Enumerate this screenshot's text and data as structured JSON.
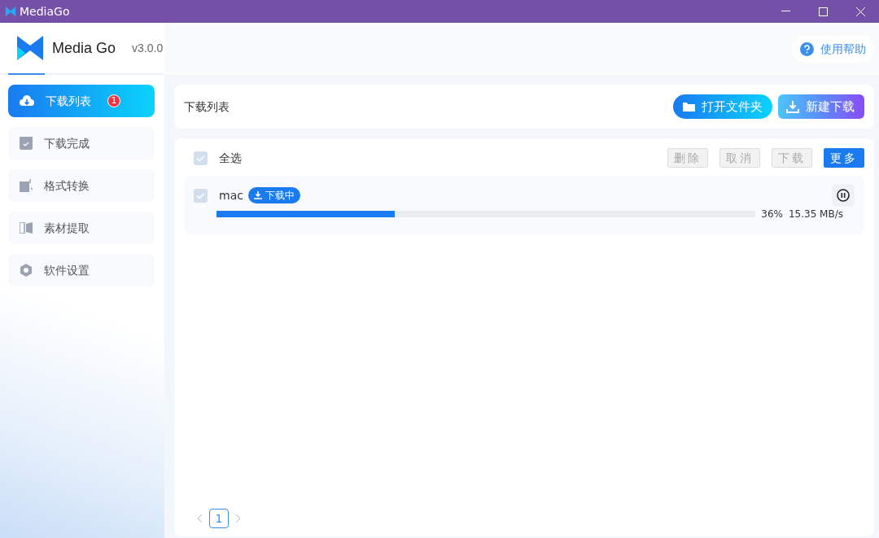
{
  "window": {
    "title": "MediaGo"
  },
  "app": {
    "name": "Media Go",
    "version": "v3.0.0"
  },
  "help": {
    "label": "使用帮助"
  },
  "sidebar": {
    "items": [
      {
        "label": "下载列表",
        "selected": true,
        "badge": "1",
        "kind": "cloud"
      },
      {
        "label": "下载完成",
        "selected": false,
        "kind": "check"
      },
      {
        "label": "格式转换",
        "selected": false,
        "kind": "convert"
      },
      {
        "label": "素材提取",
        "selected": false,
        "kind": "extract"
      },
      {
        "label": "软件设置",
        "selected": false,
        "kind": "hex"
      }
    ]
  },
  "header": {
    "title": "下载列表",
    "buttons": [
      {
        "label": "打开文件夹",
        "kind": "folder"
      },
      {
        "label": "新建下载",
        "kind": "new"
      }
    ]
  },
  "toolbar": {
    "select_all": {
      "label": "全选",
      "checked": false
    },
    "buttons": [
      {
        "label": "删除",
        "disabled": true
      },
      {
        "label": "取消",
        "disabled": true
      },
      {
        "label": "下载",
        "disabled": true
      },
      {
        "label": "更多",
        "disabled": false
      }
    ]
  },
  "downloads": [
    {
      "name": "mac",
      "checked": false,
      "status": "下载中",
      "level": 0.33,
      "percent": "36%",
      "speed": "15.35 MB/s"
    }
  ],
  "pagination": {
    "pages": [
      {
        "label": "1",
        "selected": true
      }
    ]
  }
}
